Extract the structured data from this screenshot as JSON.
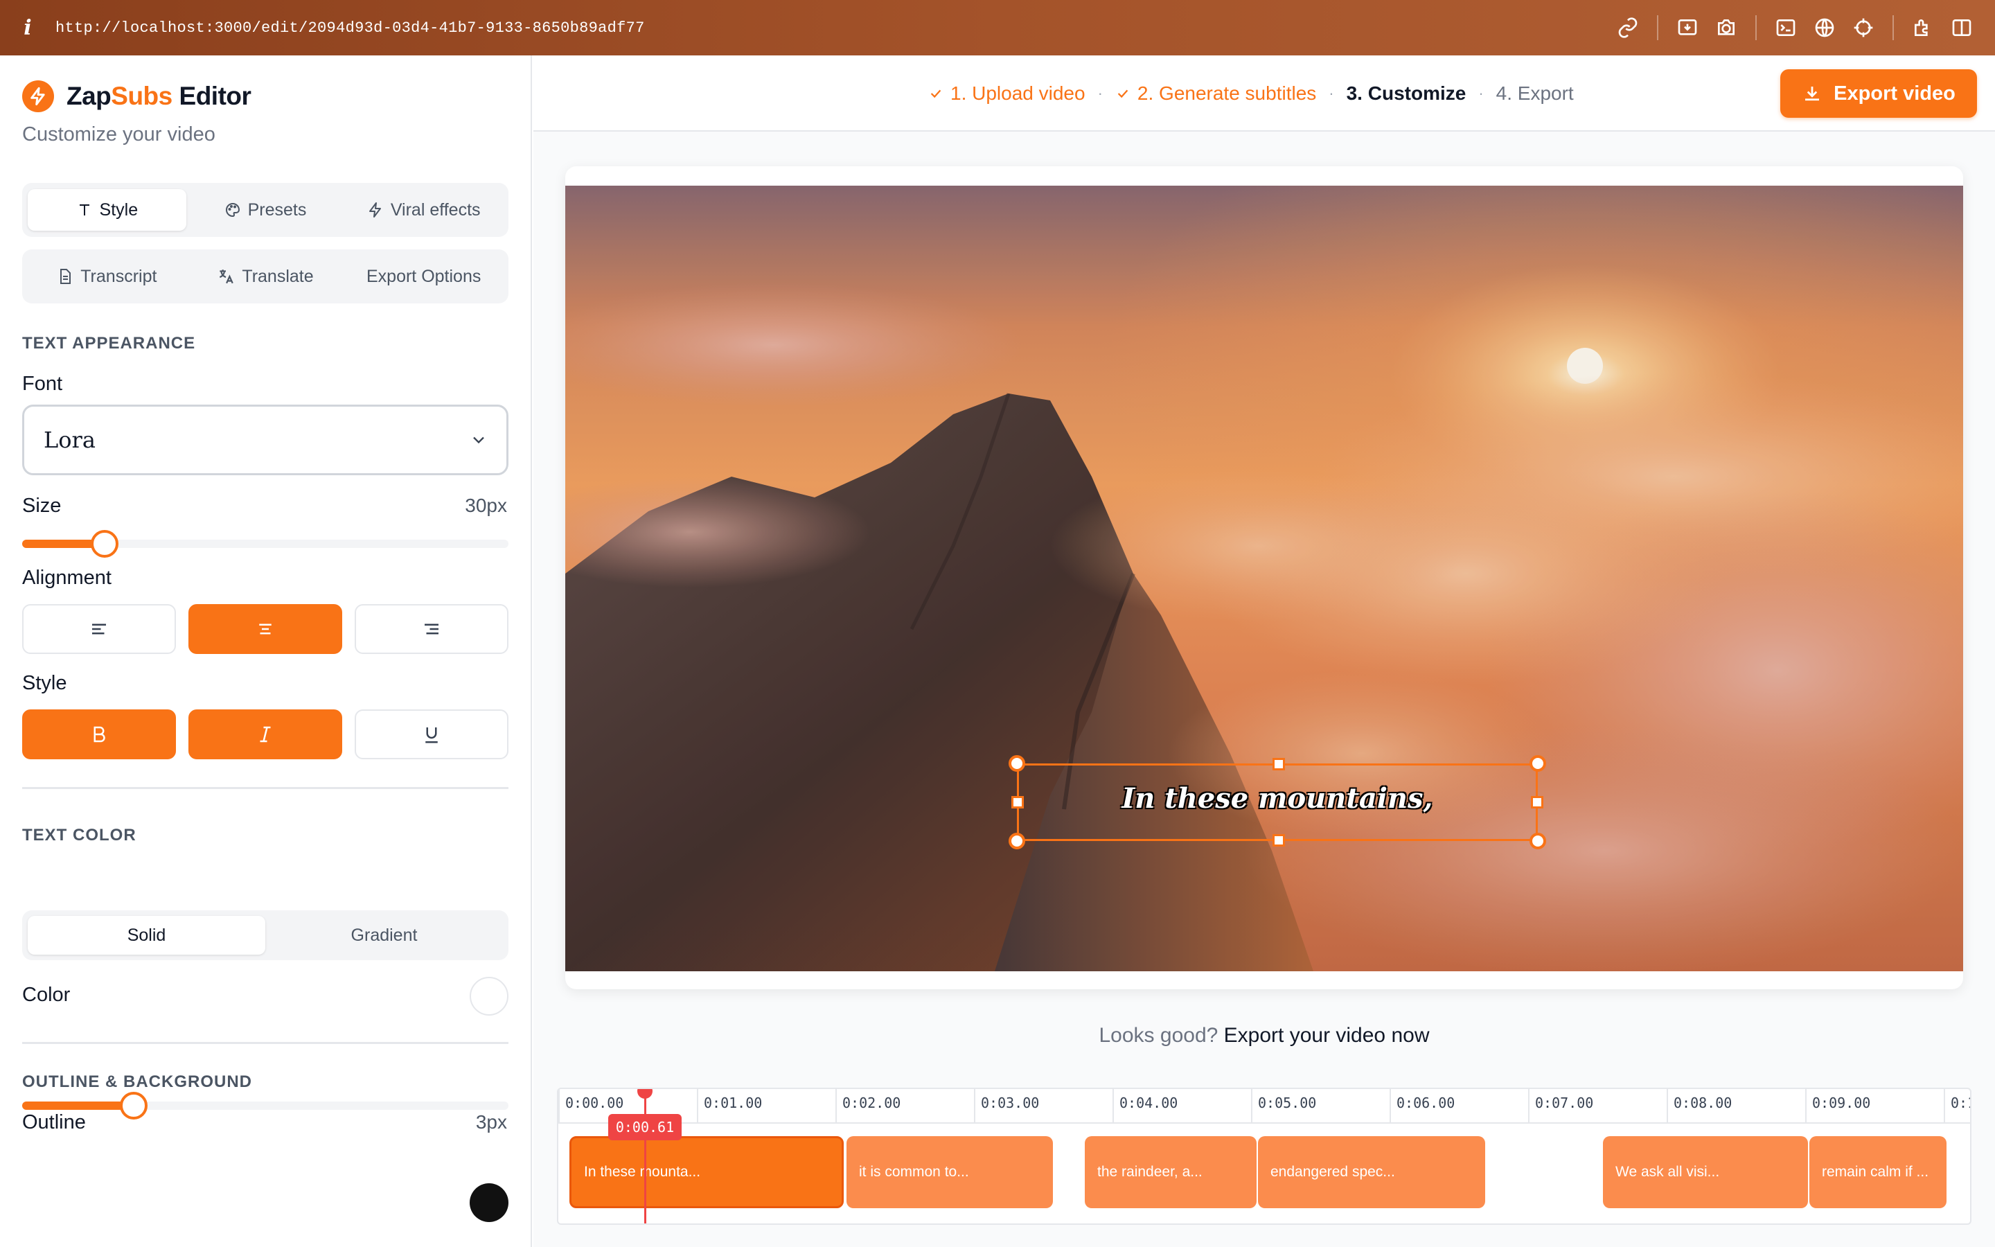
{
  "browser": {
    "info": "i",
    "url": "http://localhost:3000/edit/2094d93d-03d4-41b7-9133-8650b89adf77",
    "tools": [
      "link-icon",
      "install-icon",
      "camera-icon",
      "terminal-icon",
      "globe-icon",
      "crosshair-icon",
      "extensions-icon",
      "sidebar-icon"
    ]
  },
  "brand": {
    "name_prefix": "Zap",
    "name_accent": "Subs",
    "name_suffix": " Editor",
    "subtitle": "Customize your video",
    "accent": "#f97316"
  },
  "tabs_primary": [
    {
      "label": "Style",
      "icon": "text-icon",
      "active": true
    },
    {
      "label": "Presets",
      "icon": "palette-icon",
      "active": false
    },
    {
      "label": "Viral effects",
      "icon": "bolt-icon",
      "active": false
    }
  ],
  "tabs_secondary": [
    {
      "label": "Transcript",
      "icon": "document-icon"
    },
    {
      "label": "Translate",
      "icon": "translate-icon"
    },
    {
      "label": "Export Options",
      "icon": ""
    }
  ],
  "text_appearance": {
    "section": "TEXT APPEARANCE",
    "font_label": "Font",
    "font_value": "Lora",
    "size_label": "Size",
    "size_value": "30px",
    "size_fraction": 0.17,
    "alignment_label": "Alignment",
    "alignment_selected": "center",
    "style_label": "Style",
    "bold": true,
    "italic": true,
    "underline": false
  },
  "text_color": {
    "section": "TEXT COLOR",
    "modes": [
      "Solid",
      "Gradient"
    ],
    "active_mode": "Solid",
    "color_label": "Color",
    "color_value": "#ffffff"
  },
  "outline": {
    "section": "OUTLINE & BACKGROUND",
    "outline_label": "Outline",
    "outline_value": "3px",
    "outline_fraction": 0.23,
    "outline_color": "#111111"
  },
  "steps": [
    {
      "label": "1. Upload video",
      "state": "done"
    },
    {
      "label": "2. Generate subtitles",
      "state": "done"
    },
    {
      "label": "3. Customize",
      "state": "current"
    },
    {
      "label": "4. Export",
      "state": "todo"
    }
  ],
  "export_button": "Export video",
  "subtitle_preview": "In these mountains,",
  "cta": {
    "prefix": "Looks good? ",
    "emphasis": "Export your video now"
  },
  "timeline": {
    "ticks": [
      "0:00.00",
      "0:01.00",
      "0:02.00",
      "0:03.00",
      "0:04.00",
      "0:05.00",
      "0:06.00",
      "0:07.00",
      "0:08.00",
      "0:09.00",
      "0:1"
    ],
    "playhead": "0:00.61",
    "clips": [
      {
        "text": "In these mounta...",
        "selected": true
      },
      {
        "text": "it is common to...",
        "selected": false
      },
      {
        "text": "the raindeer, a...",
        "selected": false
      },
      {
        "text": "endangered spec...",
        "selected": false
      },
      {
        "text": "We ask all visi...",
        "selected": false
      },
      {
        "text": "remain calm if ...",
        "selected": false
      }
    ]
  }
}
